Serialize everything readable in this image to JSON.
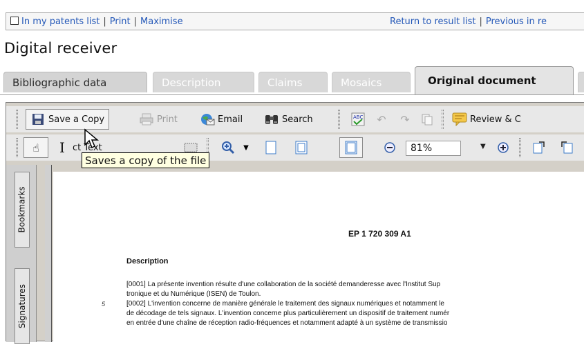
{
  "topbar": {
    "my_patents": "In my patents list",
    "print": "Print",
    "maximise": "Maximise",
    "return": "Return to result list",
    "previous": "Previous in re"
  },
  "title": "Digital receiver",
  "tabs": [
    "Bibliographic data",
    "Description",
    "Claims",
    "Mosaics",
    "Original document"
  ],
  "toolbar": {
    "save_copy": "Save a Copy",
    "print": "Print",
    "email": "Email",
    "search": "Search",
    "review": "Review & C",
    "text_select": "ct Text"
  },
  "zoom": "81%",
  "tooltip": "Saves a copy of the file",
  "side_tabs": [
    "Bookmarks",
    "Signatures"
  ],
  "document": {
    "number": "EP 1 720 309 A1",
    "section": "Description",
    "p1": "[0001]    La présente invention résulte d'une collaboration de la société demanderesse avec l'Institut Sup",
    "p1b": "tronique et du Numérique (ISEN) de Toulon.",
    "p2": "[0002]    L'invention concerne de manière générale le traitement des signaux numériques et notamment le",
    "p2b": "de décodage de tels signaux. L'invention concerne plus particulièrement un dispositif de traitement numér",
    "p2c": "en entrée d'une chaîne de réception radio-fréquences et notamment adapté à un système de transmissio",
    "line_no": "5"
  }
}
